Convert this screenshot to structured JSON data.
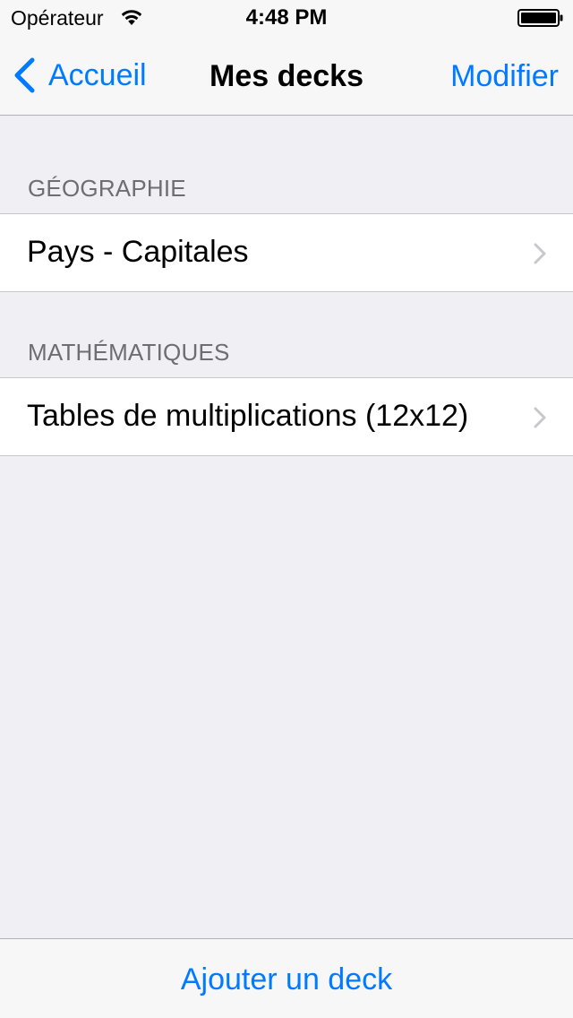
{
  "status_bar": {
    "carrier": "Opérateur",
    "time": "4:48 PM",
    "wifi_icon": "wifi-icon",
    "battery_icon": "battery-icon"
  },
  "nav_bar": {
    "back_label": "Accueil",
    "title": "Mes decks",
    "edit_label": "Modifier"
  },
  "sections": [
    {
      "header": "GÉOGRAPHIE",
      "items": [
        {
          "label": "Pays - Capitales"
        }
      ]
    },
    {
      "header": "MATHÉMATIQUES",
      "items": [
        {
          "label": "Tables de multiplications (12x12)"
        }
      ]
    }
  ],
  "toolbar": {
    "add_label": "Ajouter un deck"
  },
  "colors": {
    "tint": "#007aff",
    "background": "#efeff4",
    "section_header": "#6d6d72",
    "separator": "#c8c7cc",
    "disclosure": "#c7c7cc"
  }
}
